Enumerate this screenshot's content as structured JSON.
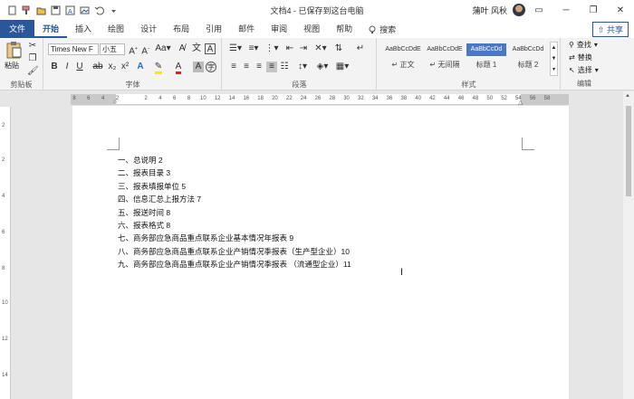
{
  "window": {
    "title": "文档4 - 已保存到这台电脑",
    "user_name": "蒲叶 风秋",
    "minimize": "─",
    "restore": "❐",
    "close": "✕"
  },
  "tabs": [
    {
      "label": "文件"
    },
    {
      "label": "开始"
    },
    {
      "label": "插入"
    },
    {
      "label": "绘图"
    },
    {
      "label": "设计"
    },
    {
      "label": "布局"
    },
    {
      "label": "引用"
    },
    {
      "label": "邮件"
    },
    {
      "label": "审阅"
    },
    {
      "label": "视图"
    },
    {
      "label": "帮助"
    }
  ],
  "search_label": "搜索",
  "share_label": "共享",
  "ribbon": {
    "clipboard": {
      "label": "剪贴板",
      "paste": "粘贴"
    },
    "font": {
      "label": "字体",
      "font_name": "Times New F",
      "font_size": "小五"
    },
    "paragraph": {
      "label": "段落"
    },
    "styles": {
      "label": "样式",
      "items": [
        {
          "sample": "AaBbCcDdE",
          "name": "↵ 正文"
        },
        {
          "sample": "AaBbCcDdE",
          "name": "↵ 无间隔"
        },
        {
          "sample": "AaBbCcDd",
          "name": "标题 1"
        },
        {
          "sample": "AaBbCcDd",
          "name": "标题 2"
        }
      ]
    },
    "editing": {
      "label": "编辑",
      "find": "查找",
      "replace": "替换",
      "select": "选择"
    }
  },
  "ruler": {
    "ticks": [
      "8",
      "6",
      "4",
      "2",
      "",
      "2",
      "4",
      "6",
      "8",
      "10",
      "12",
      "14",
      "16",
      "18",
      "20",
      "22",
      "24",
      "26",
      "28",
      "30",
      "32",
      "34",
      "36",
      "38",
      "40",
      "42",
      "44",
      "46",
      "48",
      "50",
      "52",
      "54",
      "56",
      "58"
    ]
  },
  "document": {
    "toc": [
      "一、总说明 2",
      "二、报表目录 3",
      "三、报表填报单位 5",
      "四、信息汇总上报方法 7",
      "五、报送时间 8",
      "六、报表格式 8",
      "七、商务部应急商品重点联系企业基本情况年报表 9",
      "八、商务部应急商品重点联系企业产销情况季报表（生产型企业）10",
      "九、商务部应急商品重点联系企业产销情况季报表 （流通型企业）11"
    ]
  }
}
